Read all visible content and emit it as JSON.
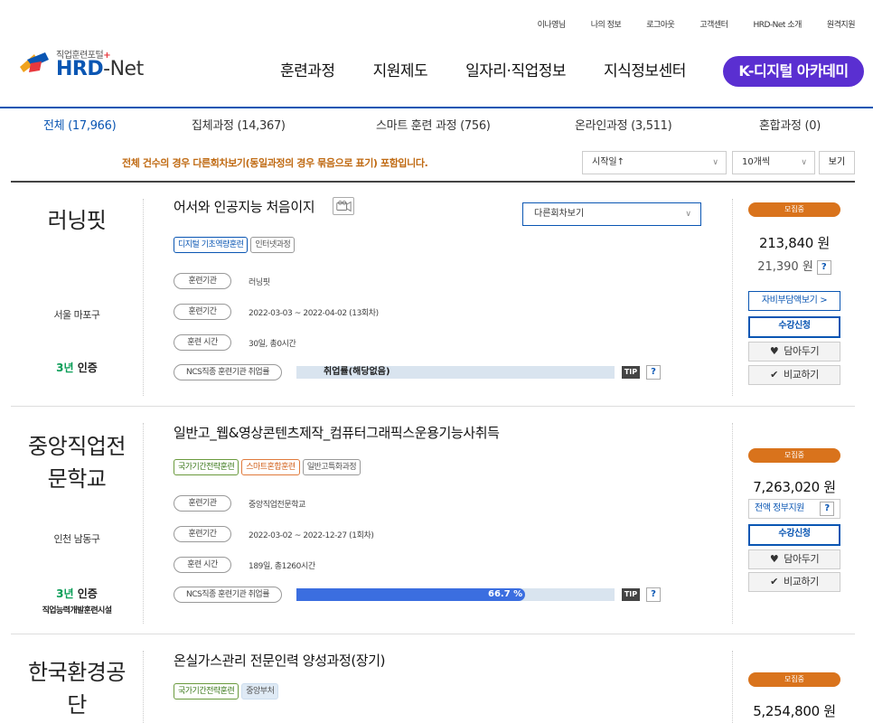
{
  "toplinks": [
    "이나영님",
    "나의 정보",
    "로그아웃",
    "고객센터",
    "HRD-Net 소개",
    "원격지원"
  ],
  "logo": {
    "sub": "직업훈련포털",
    "plus": "+",
    "name_hrd": "HRD",
    "name_dash": "-",
    "name_net": "Net"
  },
  "gnb": [
    "훈련과정",
    "지원제도",
    "일자리·직업정보",
    "지식정보센터"
  ],
  "kdigital": "K-디지털 아카데미",
  "tabs": [
    "전체 (17,966)",
    "집체과정 (14,367)",
    "스마트 훈련 과정 (756)",
    "온라인과정 (3,511)",
    "혼합과정 (0)"
  ],
  "notice": "전체 건수의 경우 다른회차보기(동일과정의 경우 묶음으로 표기) 포함입니다.",
  "sort": {
    "value": "시작일↑",
    "arrow": "∨"
  },
  "perpage": {
    "value": "10개씩",
    "arrow": "∨"
  },
  "view_label": "보기",
  "courses": [
    {
      "institution": "러닝핏",
      "location": "서울 마포구",
      "cert": "3년 인증",
      "cert_num": "3년",
      "cert_word": " 인증",
      "title": "어서와 인공지능 처음이지",
      "other_rounds": "다른회차보기",
      "tags": [
        "디지털 기초역량훈련",
        "인터넷과정"
      ],
      "org_label": "훈련기관",
      "org": "러닝핏",
      "period_label": "훈련기간",
      "period": "2022-03-03 ~ 2022-04-02 (13회차)",
      "hours_label": "훈련 시간",
      "hours": "30일, 총0시간",
      "ncs_label": "NCS직종 훈련기관 취업률",
      "employment": "취업률(해당없음)",
      "tip": "TIP",
      "q": "?",
      "status": "모집중",
      "price": "213,840 원",
      "self_price": "21,390 원",
      "self_pay_btn": "자비부담액보기 >",
      "apply": "수강신청",
      "wish": "담아두기",
      "compare": "비교하기"
    },
    {
      "institution_l1": "중앙직업전",
      "institution_l2": "문학교",
      "location": "인천 남동구",
      "cert_num": "3년",
      "cert_word": " 인증",
      "cert_sub": "직업능력개발훈련시설",
      "title": "일반고_웹&영상콘텐츠제작_컴퓨터그래픽스운용기능사취득",
      "tags": [
        "국가기간전략훈련",
        "스마트혼합훈련",
        "일반고특화과정"
      ],
      "org_label": "훈련기관",
      "org": "중앙직업전문학교",
      "period_label": "훈련기간",
      "period": "2022-03-02 ~ 2022-12-27 (1회차)",
      "hours_label": "훈련 시간",
      "hours": "189일, 총1260시간",
      "ncs_label": "NCS직종 훈련기관 취업률",
      "employment": "66.7 %",
      "employment_rate": 0.667,
      "tip": "TIP",
      "q": "?",
      "status": "모집중",
      "price": "7,263,020 원",
      "gov_support": "전액 정부지원",
      "apply": "수강신청",
      "wish": "담아두기",
      "compare": "비교하기"
    },
    {
      "institution_l1": "한국환경공",
      "institution_l2": "단",
      "title": "온실가스관리 전문인력 양성과정(장기)",
      "tags": [
        "국가기간전략훈련",
        "중앙부처"
      ],
      "status": "모집중",
      "price": "5,254,800 원"
    }
  ],
  "colors": {
    "brand": "#0a56b3",
    "kdigital": "#5a2fd1",
    "status": "#d9731c",
    "notice": "#c06b14",
    "bar_fill": "#3b6ee0",
    "bar_bg": "#d9e4ef"
  }
}
